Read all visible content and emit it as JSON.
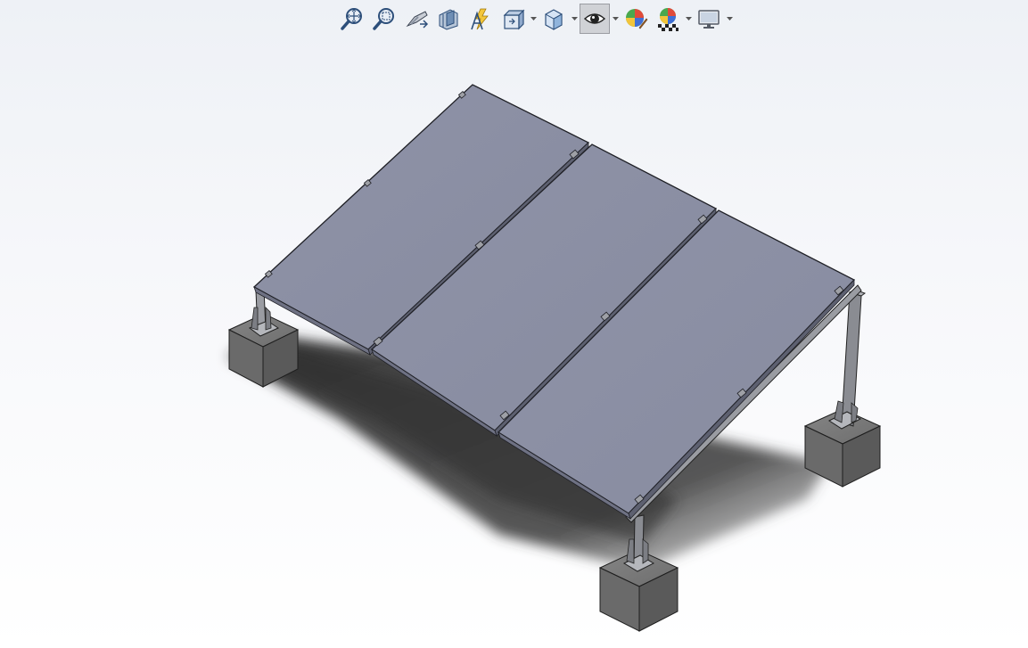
{
  "app": {
    "view": "3d-model-viewport"
  },
  "toolbar": {
    "buttons": [
      {
        "name": "zoom-to-fit-icon",
        "has_dropdown": false
      },
      {
        "name": "zoom-to-area-icon",
        "has_dropdown": false
      },
      {
        "name": "previous-view-icon",
        "has_dropdown": false
      },
      {
        "name": "section-view-icon",
        "has_dropdown": false
      },
      {
        "name": "dynamic-annotation-view-icon",
        "has_dropdown": false
      },
      {
        "name": "view-orientation-icon",
        "has_dropdown": true
      },
      {
        "name": "display-style-icon",
        "has_dropdown": true
      },
      {
        "name": "hide-show-items-icon",
        "has_dropdown": true,
        "active": true
      },
      {
        "name": "edit-appearance-icon",
        "has_dropdown": false
      },
      {
        "name": "apply-scene-icon",
        "has_dropdown": true
      },
      {
        "name": "view-settings-icon",
        "has_dropdown": true
      }
    ]
  },
  "model": {
    "description_visible": false,
    "panel_color": "#8c90a4",
    "panel_edge_color": "#2a2c33",
    "concrete_color": "#6f6f6f",
    "steel_color": "#8e9095",
    "shadow_color": "#3a3a3a"
  }
}
